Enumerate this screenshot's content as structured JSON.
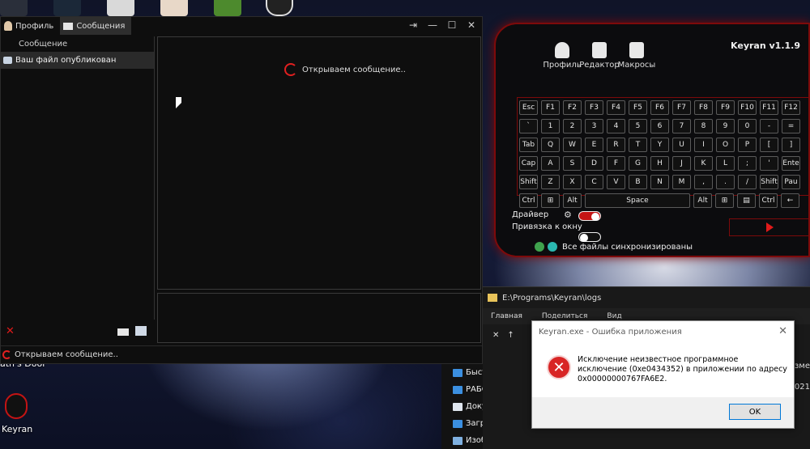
{
  "messenger": {
    "tabs": [
      {
        "label": "Профиль"
      },
      {
        "label": "Сообщения"
      }
    ],
    "column_header": "Сообщение",
    "list_items": [
      {
        "label": "Ваш файл опубликован"
      }
    ],
    "loading_text": "Открываем сообщение..",
    "status_text": "Открываем сообщение.."
  },
  "keyran": {
    "title": "Keyran v1.1.9",
    "menu": [
      {
        "label": "Профиль",
        "icon": "user-icon"
      },
      {
        "label": "Редактор",
        "icon": "keyboard-icon"
      },
      {
        "label": "Макросы",
        "icon": "macro-icon"
      }
    ],
    "keyboard_rows": [
      [
        "Esc",
        "F1",
        "F2",
        "F3",
        "F4",
        "F5",
        "F6",
        "F7",
        "F8",
        "F9",
        "F10",
        "F11",
        "F12"
      ],
      [
        "`",
        "1",
        "2",
        "3",
        "4",
        "5",
        "6",
        "7",
        "8",
        "9",
        "0",
        "-",
        "="
      ],
      [
        "Tab",
        "Q",
        "W",
        "E",
        "R",
        "T",
        "Y",
        "U",
        "I",
        "O",
        "P",
        "[",
        "]"
      ],
      [
        "Cap",
        "A",
        "S",
        "D",
        "F",
        "G",
        "H",
        "J",
        "K",
        "L",
        ";",
        "'",
        "Ente"
      ],
      [
        "Shift",
        "Z",
        "X",
        "C",
        "V",
        "B",
        "N",
        "M",
        ",",
        ".",
        "/",
        "Shift",
        "Pau"
      ],
      [
        "Ctrl",
        "⊞",
        "Alt",
        "Space",
        "Alt",
        "⊞",
        "▤",
        "Ctrl",
        "←"
      ]
    ],
    "driver_label": "Драйвер",
    "bind_label": "Привязка к окну",
    "sync_text": "Все файлы синхронизированы",
    "driver_on": true,
    "bind_on": false,
    "accent": "#c41414"
  },
  "explorer": {
    "path": "E:\\Programs\\Keyran\\logs",
    "menu": [
      "Главная",
      "Поделиться",
      "Вид"
    ],
    "sidebar": [
      {
        "label": "Быстрый досту"
      },
      {
        "label": "РАБОЧИЙ СТ"
      },
      {
        "label": "Документы"
      },
      {
        "label": "Загрузки"
      },
      {
        "label": "Изображен"
      }
    ],
    "partial_right": [
      "изме",
      "021"
    ]
  },
  "error_dialog": {
    "title": "Keyran.exe - Ошибка приложения",
    "message": "Исключение неизвестное программное исключение (0xe0434352) в приложении по адресу 0x00000000767FA6E2.",
    "ok_label": "OK"
  },
  "desktop": {
    "bottom_icon_label": "Keyran",
    "partial_label": "ath's Door"
  }
}
